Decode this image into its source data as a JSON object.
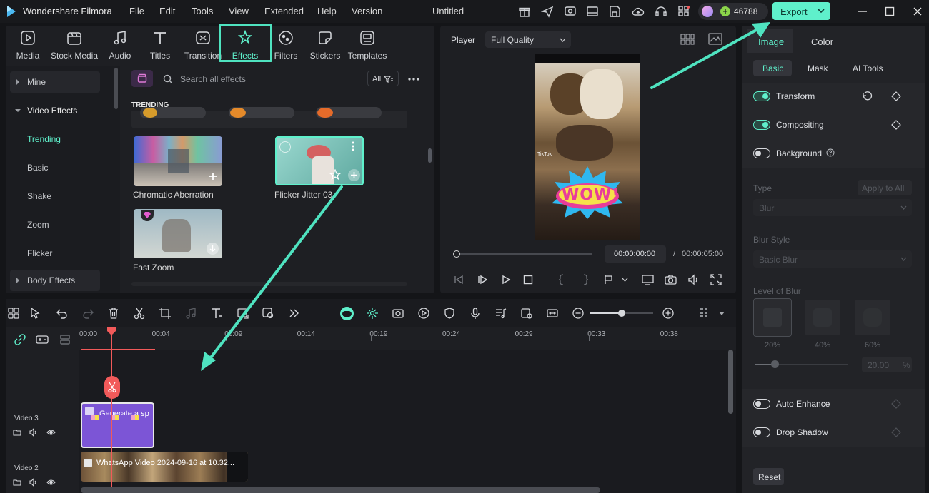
{
  "app": {
    "name": "Wondershare Filmora",
    "doc_title": "Untitled"
  },
  "menu": [
    "File",
    "Edit",
    "Tools",
    "View",
    "Extended",
    "Help",
    "Version"
  ],
  "titlebar": {
    "credits": "46788",
    "export_label": "Export"
  },
  "media_toolbar": [
    {
      "label": "Media",
      "icon": "media-icon"
    },
    {
      "label": "Stock Media",
      "icon": "stock-media-icon"
    },
    {
      "label": "Audio",
      "icon": "audio-icon"
    },
    {
      "label": "Titles",
      "icon": "titles-icon"
    },
    {
      "label": "Transition",
      "icon": "transition-icon"
    },
    {
      "label": "Effects",
      "icon": "effects-icon"
    },
    {
      "label": "Filters",
      "icon": "filters-icon"
    },
    {
      "label": "Stickers",
      "icon": "stickers-icon"
    },
    {
      "label": "Templates",
      "icon": "templates-icon"
    }
  ],
  "sidebar": {
    "mine": "Mine",
    "video_effects": "Video Effects",
    "items": [
      "Trending",
      "Basic",
      "Shake",
      "Zoom",
      "Flicker"
    ],
    "body_effects": "Body Effects"
  },
  "effects": {
    "search_placeholder": "Search all effects",
    "filter_label": "All",
    "section_title": "TRENDING",
    "cards": [
      "Chromatic Aberration",
      "Flicker Jitter 03",
      "Fast Zoom"
    ]
  },
  "player": {
    "label": "Player",
    "quality": "Full Quality",
    "current_time": "00:00:00:00",
    "separator": "/",
    "total_time": "00:00:05:00",
    "progress": 0
  },
  "properties": {
    "tabs": [
      "Image",
      "Color"
    ],
    "subtabs": [
      "Basic",
      "Mask",
      "AI Tools"
    ],
    "transform": "Transform",
    "compositing": "Compositing",
    "background": "Background",
    "type_label": "Type",
    "apply_all": "Apply to All",
    "type_value": "Blur",
    "blur_style_label": "Blur Style",
    "blur_style_value": "Basic Blur",
    "level_label": "Level of Blur",
    "levels": [
      "20%",
      "40%",
      "60%"
    ],
    "level_value": "20.00",
    "level_unit": "%",
    "auto_enhance": "Auto Enhance",
    "drop_shadow": "Drop Shadow",
    "reset": "Reset"
  },
  "timeline": {
    "ruler": [
      "00:00",
      "00:04",
      "00:09",
      "00:14",
      "00:19",
      "00:24",
      "00:29",
      "00:33",
      "00:38"
    ],
    "tracks": [
      "Video 3",
      "Video 2"
    ],
    "clip3_label": "Generate a sp",
    "clip2_label": "WhatsApp Video 2024-09-16 at 10.32..."
  },
  "colors": {
    "accent": "#5ff0cb",
    "playhead": "#f25a5a",
    "clip_purple": "#7c55d6"
  }
}
